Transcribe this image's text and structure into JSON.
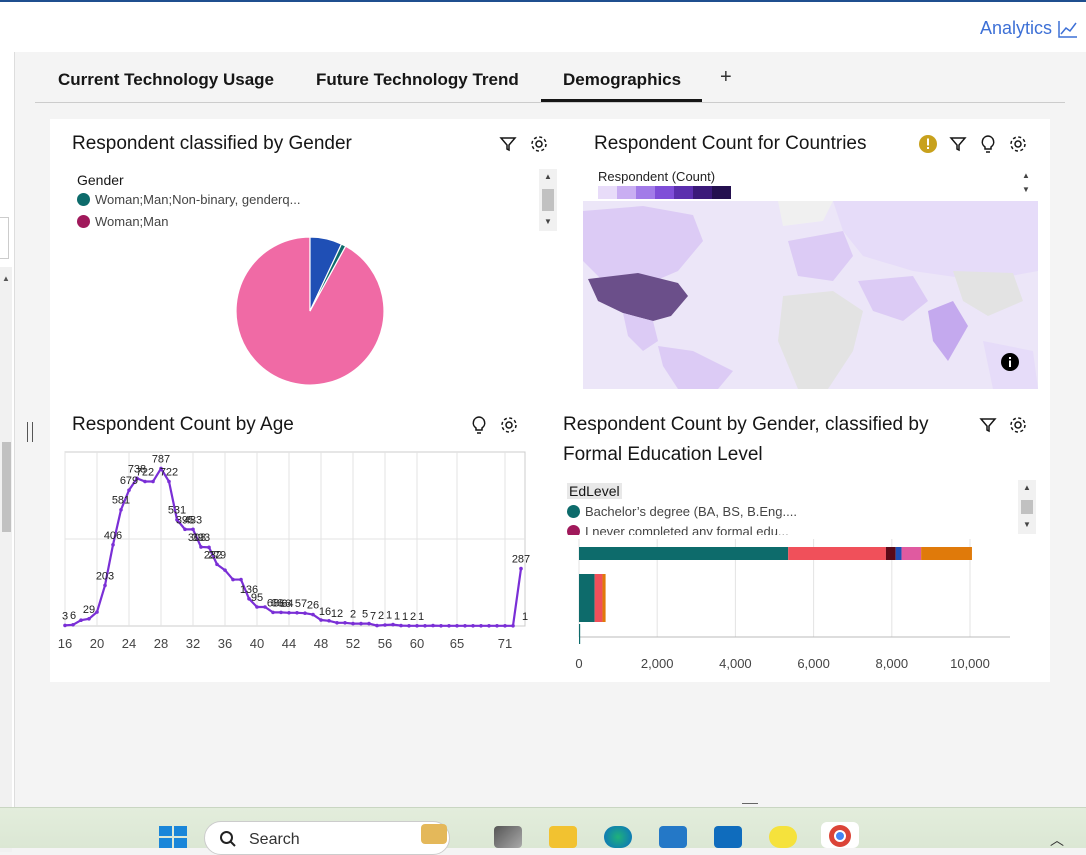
{
  "header": {
    "analytics_label": "Analytics"
  },
  "tabs": [
    {
      "label": "Current Technology Usage"
    },
    {
      "label": "Future Technology Trend"
    },
    {
      "label": "Demographics"
    }
  ],
  "tab_add": "+",
  "gender_card": {
    "title": "Respondent classified by Gender",
    "legend_title": "Gender",
    "legend": [
      "Woman;Man;Non-binary, genderq...",
      "Woman;Man"
    ],
    "colors": {
      "s1": "#0d6b6b",
      "s2": "#a0195b",
      "pink": "#f06aa5",
      "blue": "#1f4fb5"
    }
  },
  "country_card": {
    "title": "Respondent Count for Countries",
    "legend_title": "Respondent (Count)",
    "scale_colors": [
      "#e8dcf9",
      "#c9aef2",
      "#a27be8",
      "#7f4ed8",
      "#5b2fae",
      "#3b1a7a",
      "#24104f"
    ]
  },
  "age_card": {
    "title": "Respondent Count by Age"
  },
  "edu_card": {
    "title_line1": "Respondent  Count by Gender, classified by",
    "title_line2": "Formal Education Level",
    "legend_title": "EdLevel",
    "legend": [
      "Bachelor’s degree (BA, BS, B.Eng....",
      "I never completed any formal edu..."
    ]
  },
  "chart_data": [
    {
      "type": "pie",
      "title": "Respondent classified by Gender",
      "slices": [
        {
          "label": "Woman;Man",
          "value": 92,
          "color": "#f06aa5"
        },
        {
          "label": "Woman;Man;Non-binary, genderq...",
          "value": 7,
          "color": "#1f4fb5"
        },
        {
          "label": "other",
          "value": 1,
          "color": "#0d6b6b"
        }
      ]
    },
    {
      "type": "line",
      "title": "Respondent Count by Age",
      "x_ticks": [
        "16",
        "20",
        "24",
        "28",
        "32",
        "36",
        "40",
        "44",
        "48",
        "52",
        "56",
        "60",
        "65",
        "71"
      ],
      "x": [
        16,
        17,
        18,
        19,
        20,
        21,
        22,
        23,
        24,
        25,
        26,
        27,
        28,
        29,
        30,
        31,
        32,
        33,
        34,
        35,
        36,
        37,
        38,
        39,
        40,
        41,
        42,
        43,
        44,
        45,
        46,
        47,
        48,
        49,
        50,
        51,
        52,
        53,
        54,
        55,
        56,
        57,
        58,
        59,
        60,
        61,
        62,
        63,
        64,
        65,
        66,
        67,
        68,
        69,
        70,
        71,
        72,
        73
      ],
      "values": [
        3,
        6,
        29,
        36,
        70,
        203,
        406,
        581,
        679,
        738,
        722,
        722,
        787,
        722,
        531,
        483,
        483,
        395,
        393,
        308,
        279,
        232,
        232,
        136,
        95,
        95,
        68,
        68,
        66,
        66,
        64,
        57,
        30,
        26,
        16,
        16,
        12,
        12,
        12,
        2,
        5,
        7,
        2,
        1,
        1,
        1,
        2,
        1,
        1,
        1,
        1,
        1,
        1,
        1,
        1,
        1,
        1,
        287
      ],
      "labels": [
        {
          "x": 16,
          "text": "3"
        },
        {
          "x": 17,
          "text": "6"
        },
        {
          "x": 19,
          "text": "29"
        },
        {
          "x": 21,
          "text": "203"
        },
        {
          "x": 22,
          "text": "406"
        },
        {
          "x": 23,
          "text": "581"
        },
        {
          "x": 24,
          "text": "679"
        },
        {
          "x": 25,
          "text": "738"
        },
        {
          "x": 26,
          "text": "722"
        },
        {
          "x": 28,
          "text": "787"
        },
        {
          "x": 29,
          "text": "722"
        },
        {
          "x": 30,
          "text": "531"
        },
        {
          "x": 32,
          "text": "483"
        },
        {
          "x": 31,
          "text": "395"
        },
        {
          "x": 33,
          "text": "393"
        },
        {
          "x": 32.5,
          "text": "308"
        },
        {
          "x": 35,
          "text": "279"
        },
        {
          "x": 34.5,
          "text": "232"
        },
        {
          "x": 39,
          "text": "136"
        },
        {
          "x": 40,
          "text": "95"
        },
        {
          "x": 42,
          "text": "68"
        },
        {
          "x": 43.5,
          "text": "66"
        },
        {
          "x": 42.5,
          "text": "66"
        },
        {
          "x": 43.8,
          "text": "64"
        },
        {
          "x": 45.5,
          "text": "57"
        },
        {
          "x": 47,
          "text": "26"
        },
        {
          "x": 48.5,
          "text": "16"
        },
        {
          "x": 50,
          "text": "12"
        },
        {
          "x": 52,
          "text": "2"
        },
        {
          "x": 53.5,
          "text": "5"
        },
        {
          "x": 54.5,
          "text": "7"
        },
        {
          "x": 55.5,
          "text": "2"
        },
        {
          "x": 56.5,
          "text": "1"
        },
        {
          "x": 57.5,
          "text": "1"
        },
        {
          "x": 58.5,
          "text": "1"
        },
        {
          "x": 59.5,
          "text": "2"
        },
        {
          "x": 60.5,
          "text": "1"
        },
        {
          "x": 73,
          "text": "287"
        },
        {
          "x": 73.5,
          "text": "1"
        }
      ],
      "ylim": [
        0,
        800
      ]
    },
    {
      "type": "bar",
      "orientation": "horizontal",
      "stacked": true,
      "title": "Respondent  Count by Gender, classified by Formal Education Level",
      "x_ticks": [
        "0",
        "2,000",
        "4,000",
        "6,000",
        "8,000",
        "10,000"
      ],
      "xlim": [
        0,
        10000
      ],
      "rows": [
        {
          "segments": [
            5350,
            2500,
            250,
            150,
            500,
            1300
          ],
          "colors": [
            "#0d6b6b",
            "#f0505a",
            "#5a0a18",
            "#1f4fb5",
            "#e05aa0",
            "#e07a0a"
          ]
        },
        {
          "segments": [
            400,
            200,
            80
          ],
          "colors": [
            "#0d6b6b",
            "#f0505a",
            "#e07a0a"
          ]
        },
        {
          "segments": [
            30
          ],
          "colors": [
            "#0d6b6b"
          ]
        }
      ]
    }
  ],
  "taskbar": {
    "search_label": "Search"
  }
}
